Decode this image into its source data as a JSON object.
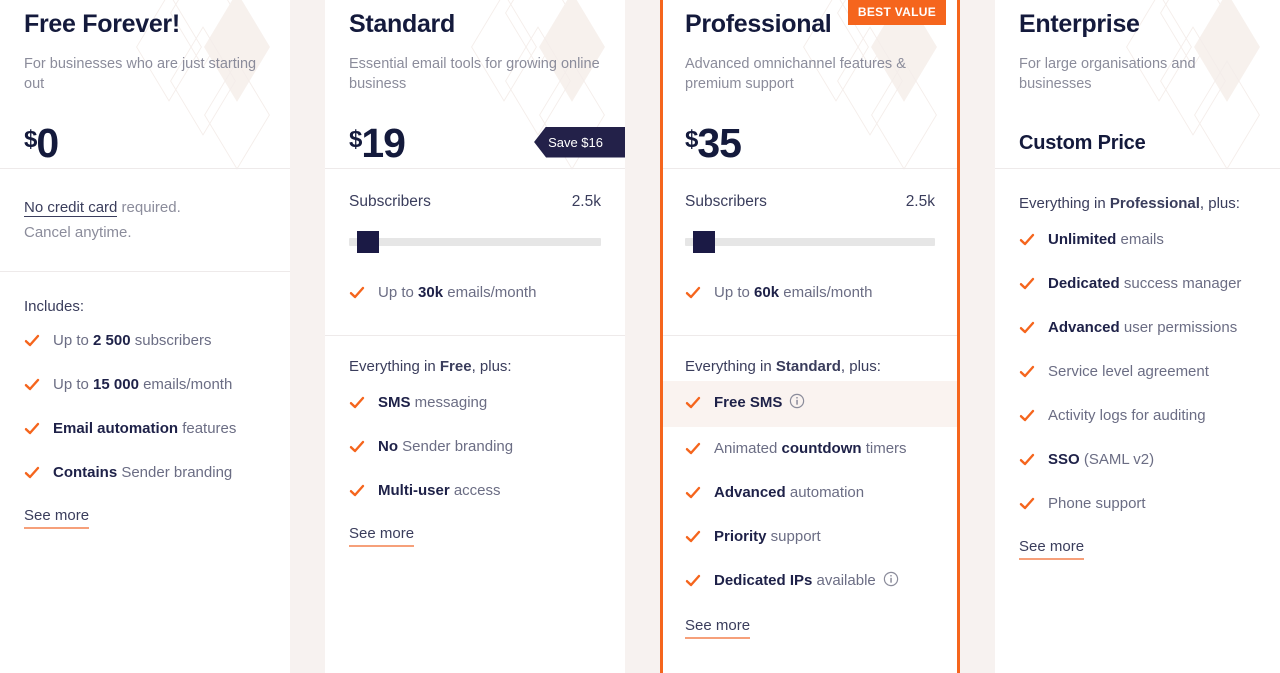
{
  "colors": {
    "accent_orange": "#f5651d",
    "navy": "#141a3c",
    "ribbon_navy": "#232149",
    "page_bg": "#f7f2f0",
    "highlight_row": "#faf3f0",
    "see_more_underline": "#f6a07a"
  },
  "plans": [
    {
      "id": "free",
      "title": "Free Forever!",
      "description": "For businesses who are just starting out",
      "currency": "$",
      "amount": "0",
      "note": {
        "link_text": "No credit card",
        "rest_text": " required.",
        "line2": "Cancel anytime."
      },
      "includes_label": "Includes:",
      "features": [
        {
          "pre": "Up to ",
          "bold": "2 500",
          "post": " subscribers"
        },
        {
          "pre": "Up to ",
          "bold": "15 000",
          "post": " emails/month"
        },
        {
          "pre": "",
          "bold": "Email automation",
          "post": " features"
        },
        {
          "pre": "",
          "bold": "Contains",
          "post": " Sender branding"
        }
      ],
      "see_more": "See more"
    },
    {
      "id": "standard",
      "title": "Standard",
      "description": "Essential email tools for growing online business",
      "currency": "$",
      "amount": "19",
      "badge": "Save $16",
      "subscribers": {
        "label": "Subscribers",
        "value": "2.5k",
        "slider_percent": 3
      },
      "email_feature": {
        "pre": "Up to ",
        "bold": "30k",
        "post": " emails/month"
      },
      "everything_pre": "Everything in ",
      "everything_bold": "Free",
      "everything_post": ", plus:",
      "features": [
        {
          "pre": "",
          "bold": "SMS",
          "post": " messaging"
        },
        {
          "pre": "",
          "bold": "No",
          "post": " Sender branding"
        },
        {
          "pre": "",
          "bold": "Multi-user",
          "post": " access"
        }
      ],
      "see_more": "See more"
    },
    {
      "id": "professional",
      "title": "Professional",
      "description": "Advanced omnichannel features & premium support",
      "currency": "$",
      "amount": "35",
      "ribbon": "BEST VALUE",
      "subscribers": {
        "label": "Subscribers",
        "value": "2.5k",
        "slider_percent": 3
      },
      "email_feature": {
        "pre": "Up to ",
        "bold": "60k",
        "post": " emails/month"
      },
      "everything_pre": "Everything in ",
      "everything_bold": "Standard",
      "everything_post": ", plus:",
      "features": [
        {
          "pre": "",
          "bold": "Free SMS",
          "post": "",
          "info": true,
          "highlight": true
        },
        {
          "pre": "Animated ",
          "bold": "countdown",
          "post": " timers"
        },
        {
          "pre": "",
          "bold": "Advanced",
          "post": " automation"
        },
        {
          "pre": "",
          "bold": "Priority",
          "post": " support"
        },
        {
          "pre": "",
          "bold": "Dedicated IPs",
          "post": " available",
          "info": true
        }
      ],
      "see_more": "See more"
    },
    {
      "id": "enterprise",
      "title": "Enterprise",
      "description": "For large organisations and businesses",
      "custom_price": "Custom Price",
      "everything_pre": "Everything in ",
      "everything_bold": "Professional",
      "everything_post": ", plus:",
      "features": [
        {
          "pre": "",
          "bold": "Unlimited",
          "post": " emails"
        },
        {
          "pre": "",
          "bold": "Dedicated",
          "post": " success manager"
        },
        {
          "pre": "",
          "bold": "Advanced",
          "post": " user permissions"
        },
        {
          "pre": "",
          "bold": "",
          "post": "Service level agreement"
        },
        {
          "pre": "",
          "bold": "",
          "post": "Activity logs for auditing"
        },
        {
          "pre": "",
          "bold": "SSO",
          "post": " (SAML v2)"
        },
        {
          "pre": "",
          "bold": "",
          "post": "Phone support"
        }
      ],
      "see_more": "See more"
    }
  ]
}
